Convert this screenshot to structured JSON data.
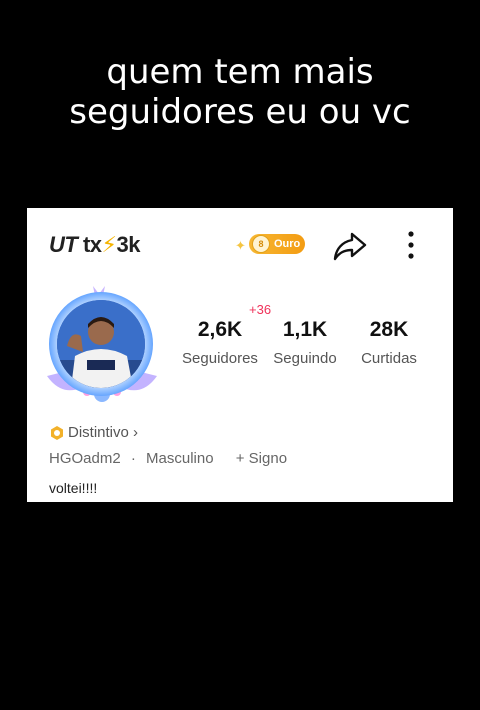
{
  "caption": {
    "line1": "quem tem mais",
    "line2": "seguidores eu ou vc"
  },
  "profile": {
    "title_ut": "UT",
    "title_rest": " tx",
    "title_bolt": "⚡",
    "title_count": "3k",
    "badge_label": "Ouro",
    "badge_coin": "8",
    "followers_delta": "+36",
    "stats": [
      {
        "value": "2,6K",
        "label": "Seguidores"
      },
      {
        "value": "1,1K",
        "label": "Seguindo"
      },
      {
        "value": "28K",
        "label": "Curtidas"
      }
    ],
    "distintivo_label": "Distintivo",
    "distintivo_chevron": "›",
    "username": "HGOadm2",
    "separator": "·",
    "gender": "Masculino",
    "sign_label": "+ Signo",
    "bio": "voltei!!!!"
  },
  "colors": {
    "background": "#000000",
    "card": "#ffffff",
    "badge": "#f39c12",
    "delta": "#f0325a"
  },
  "icons": [
    "share-icon",
    "more-icon",
    "hexagon-badge-icon",
    "spark-icon",
    "coin-icon"
  ]
}
